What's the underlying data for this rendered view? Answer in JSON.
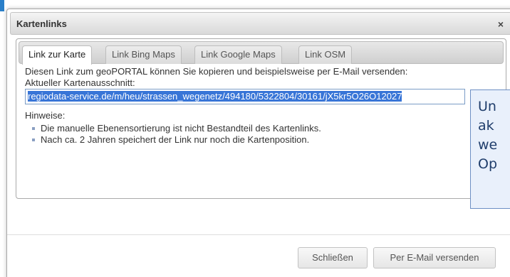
{
  "dialog": {
    "title": "Kartenlinks",
    "close_icon": "×"
  },
  "tabs": [
    {
      "label": "Link zur Karte",
      "active": true
    },
    {
      "label": "Link Bing Maps",
      "active": false
    },
    {
      "label": "Link Google Maps",
      "active": false
    },
    {
      "label": "Link OSM",
      "active": false
    }
  ],
  "content": {
    "description": "Diesen Link zum geoPORTAL können Sie kopieren und beispielsweise per E-Mail versenden:",
    "current_section_label": "Aktueller Kartenausschnitt:",
    "link_value": "regiodata-service.de/m/heu/strassen_wegenetz/494180/5322804/30161/jX5kr5O26O12027",
    "hints_label": "Hinweise:",
    "hints": [
      "Die manuelle Ebenensortierung ist nicht Bestandteil des Kartenlinks.",
      "Nach ca. 2 Jahren speichert der Link nur noch die Kartenposition."
    ]
  },
  "tooltip": {
    "lines": [
      "Un",
      "ak",
      "we",
      "Op"
    ]
  },
  "footer": {
    "close_label": "Schließen",
    "email_label": "Per E-Mail versenden"
  },
  "colors": {
    "accent": "#2a7fc9",
    "selection": "#3875d7",
    "tooltip_bg": "#e9f0fb",
    "tooltip_border": "#6d8fc4"
  }
}
